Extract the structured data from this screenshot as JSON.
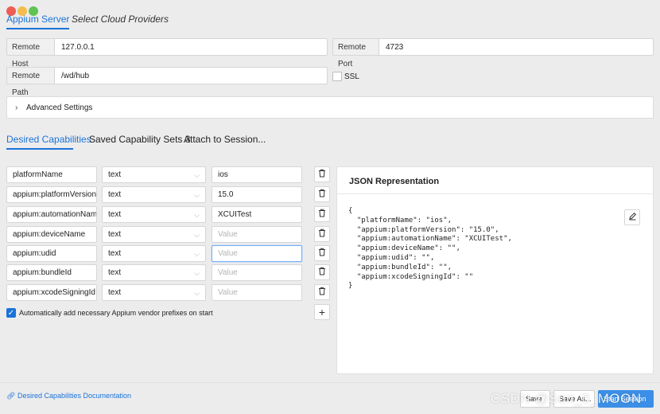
{
  "top_tabs": [
    {
      "label": "Appium Server"
    },
    {
      "label": "Select Cloud Providers"
    }
  ],
  "server": {
    "remote_host_label": "Remote Host",
    "remote_host_value": "127.0.0.1",
    "remote_port_label": "Remote Port",
    "remote_port_value": "4723",
    "remote_path_label": "Remote Path",
    "remote_path_value": "/wd/hub",
    "ssl_label": "SSL",
    "advanced_label": "Advanced Settings"
  },
  "cap_tabs": [
    {
      "label": "Desired Capabilities"
    },
    {
      "label": "Saved Capability Sets 3"
    },
    {
      "label": "Attach to Session..."
    }
  ],
  "capabilities": [
    {
      "name": "platformName",
      "type": "text",
      "value": "ios",
      "placeholder": ""
    },
    {
      "name": "appium:platformVersion",
      "type": "text",
      "value": "15.0",
      "placeholder": ""
    },
    {
      "name": "appium:automationName",
      "type": "text",
      "value": "XCUITest",
      "placeholder": ""
    },
    {
      "name": "appium:deviceName",
      "type": "text",
      "value": "",
      "placeholder": "Value"
    },
    {
      "name": "appium:udid",
      "type": "text",
      "value": "",
      "placeholder": "Value"
    },
    {
      "name": "appium:bundleId",
      "type": "text",
      "value": "",
      "placeholder": "Value"
    },
    {
      "name": "appium:xcodeSigningId",
      "type": "text",
      "value": "",
      "placeholder": "Value"
    }
  ],
  "auto_prefix_label": "Automatically add necessary Appium vendor prefixes on start",
  "json_panel": {
    "title": "JSON Representation",
    "code": "{\n  \"platformName\": \"ios\",\n  \"appium:platformVersion\": \"15.0\",\n  \"appium:automationName\": \"XCUITest\",\n  \"appium:deviceName\": \"\",\n  \"appium:udid\": \"\",\n  \"appium:bundleId\": \"\",\n  \"appium:xcodeSigningId\": \"\"\n}"
  },
  "footer": {
    "doc_link": "Desired Capabilities Documentation",
    "save_label": "Save",
    "save_as_label": "Save As...",
    "start_label": "Start Session"
  },
  "watermark": "CSDN @Sun_0_MOON",
  "colors": {
    "accent": "#1a73d9",
    "primary_button": "#3b8fe6"
  },
  "icons": {
    "trash": "trash-icon",
    "add": "plus-icon",
    "edit": "pencil-icon",
    "link": "link-icon",
    "chevron": "chevron-right-icon"
  }
}
